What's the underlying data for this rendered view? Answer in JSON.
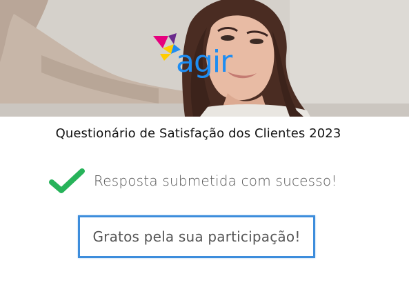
{
  "brand": {
    "name": "agir",
    "colors": {
      "wordmark": "#1e8df2",
      "mark_magenta": "#e6007e",
      "mark_yellow": "#ffcc00",
      "mark_blue": "#1e8df2",
      "mark_purple": "#6a2a8c"
    }
  },
  "hero": {
    "image": "woman-smiling-photo"
  },
  "survey": {
    "title": "Questionário de Satisfação dos Clientes 2023"
  },
  "confirmation": {
    "icon": "checkmark-icon",
    "icon_color": "#27b35a",
    "message": "Resposta submetida com sucesso!"
  },
  "thanks": {
    "message": "Gratos pela sua participação!",
    "border_color": "#3d8ddc"
  }
}
